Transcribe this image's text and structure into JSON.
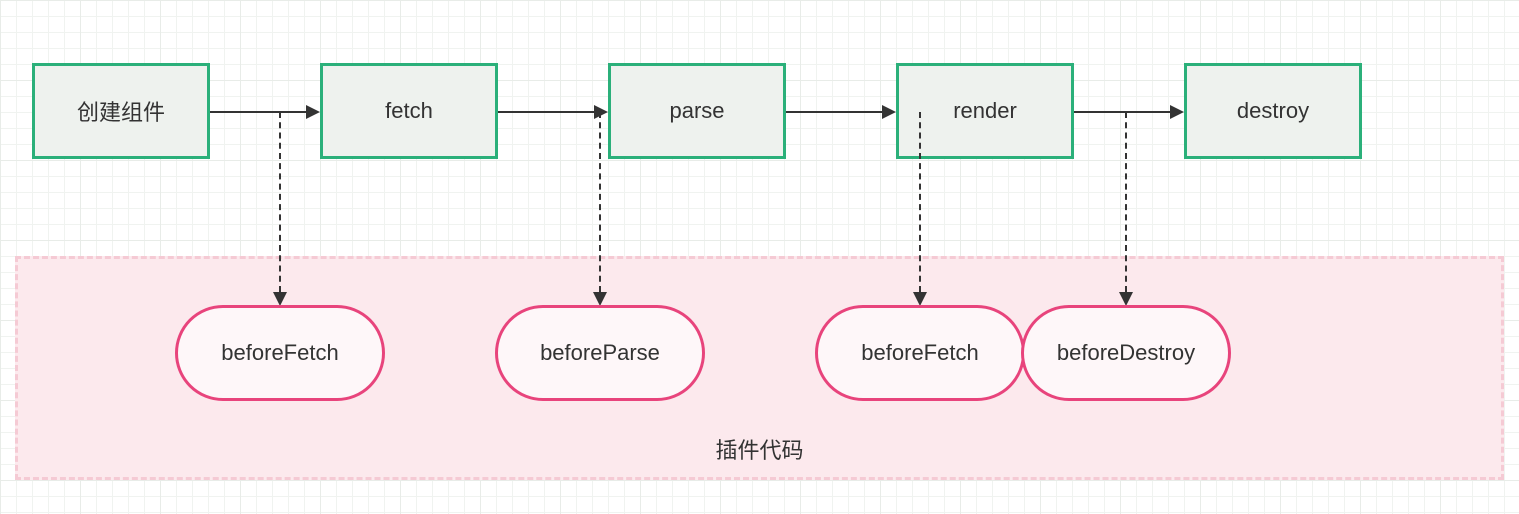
{
  "lifecycle": {
    "create": "创建组件",
    "fetch": "fetch",
    "parse": "parse",
    "render": "render",
    "destroy": "destroy"
  },
  "hooks": {
    "beforeFetch": "beforeFetch",
    "beforeParse": "beforeParse",
    "beforeFetch2": "beforeFetch",
    "beforeDestroy": "beforeDestroy"
  },
  "plugin_section_label": "插件代码",
  "chart_data": {
    "type": "diagram",
    "title": "",
    "nodes": [
      {
        "id": "create",
        "label": "创建组件",
        "shape": "rect",
        "group": "lifecycle"
      },
      {
        "id": "fetch",
        "label": "fetch",
        "shape": "rect",
        "group": "lifecycle"
      },
      {
        "id": "parse",
        "label": "parse",
        "shape": "rect",
        "group": "lifecycle"
      },
      {
        "id": "render",
        "label": "render",
        "shape": "rect",
        "group": "lifecycle"
      },
      {
        "id": "destroy",
        "label": "destroy",
        "shape": "rect",
        "group": "lifecycle"
      },
      {
        "id": "beforeFetch",
        "label": "beforeFetch",
        "shape": "rounded",
        "group": "plugin"
      },
      {
        "id": "beforeParse",
        "label": "beforeParse",
        "shape": "rounded",
        "group": "plugin"
      },
      {
        "id": "beforeFetch2",
        "label": "beforeFetch",
        "shape": "rounded",
        "group": "plugin"
      },
      {
        "id": "beforeDestroy",
        "label": "beforeDestroy",
        "shape": "rounded",
        "group": "plugin"
      }
    ],
    "edges": [
      {
        "from": "create",
        "to": "fetch",
        "style": "solid"
      },
      {
        "from": "fetch",
        "to": "parse",
        "style": "solid"
      },
      {
        "from": "parse",
        "to": "render",
        "style": "solid"
      },
      {
        "from": "render",
        "to": "destroy",
        "style": "solid"
      },
      {
        "from": "create-fetch-mid",
        "to": "beforeFetch",
        "style": "dashed"
      },
      {
        "from": "fetch-parse-mid",
        "to": "beforeParse",
        "style": "dashed"
      },
      {
        "from": "parse-render-mid",
        "to": "beforeFetch2",
        "style": "dashed"
      },
      {
        "from": "render-destroy-mid",
        "to": "beforeDestroy",
        "style": "dashed"
      }
    ],
    "groups": [
      {
        "id": "plugin",
        "label": "插件代码",
        "style": "dashed-border",
        "color": "#fce9ed"
      }
    ],
    "colors": {
      "lifecycle_border": "#2bb07a",
      "lifecycle_fill": "#eef2ee",
      "plugin_border": "#e8447c",
      "plugin_fill": "#fef7f9",
      "plugin_container_fill": "#fce9ed",
      "plugin_container_border": "#f5cad4"
    }
  }
}
